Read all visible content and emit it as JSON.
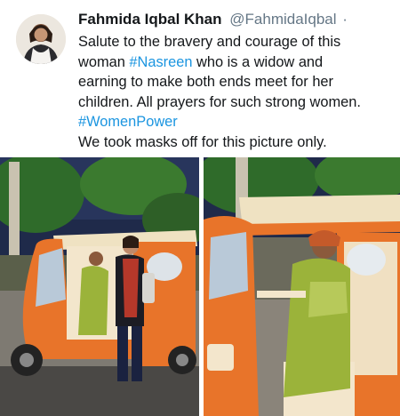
{
  "tweet": {
    "author_name": "Fahmida Iqbal Khan",
    "handle": "@FahmidaIqbal",
    "separator": "·",
    "text_line1": "Salute to the bravery and courage of this",
    "text_line2_pre": "woman ",
    "text_line2_hashtag": "#Nasreen",
    "text_line2_post": " who is a widow and",
    "text_line3": "earning to make both ends meet for her",
    "text_line4": "children. All prayers for such strong women.",
    "hashtag2": "#WomenPower",
    "text_line6": "We took masks off for this picture only."
  },
  "colors": {
    "hashtag": "#1b95e0",
    "name": "#14171a",
    "handle": "#657786",
    "rickshaw_orange": "#e8742a",
    "rickshaw_cream": "#f3e6cc",
    "dress_green": "#9bb33a"
  },
  "icons": {
    "avatar": "profile-photo",
    "left_photo": "rickshaw-photo-with-two-women",
    "right_photo": "rickshaw-driver-photo"
  }
}
